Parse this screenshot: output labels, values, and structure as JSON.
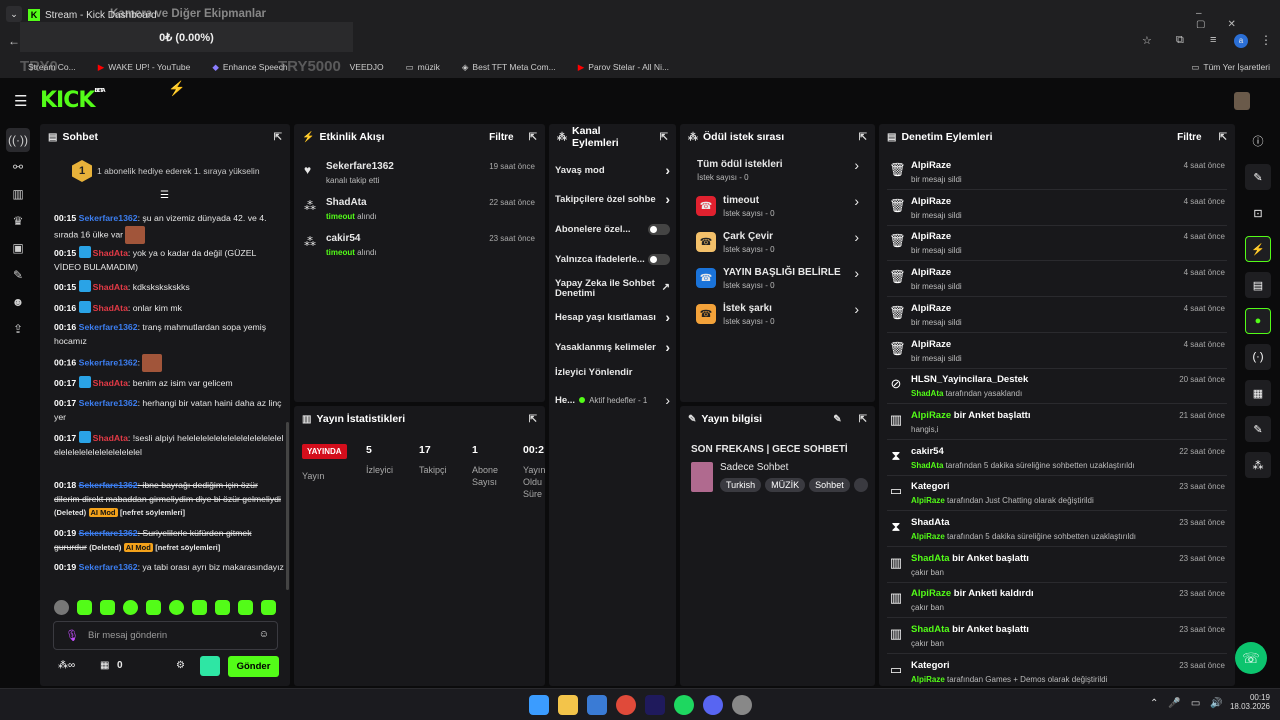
{
  "browser": {
    "tab_title": "Stream - Kick Dashboard",
    "overlay_title": "Kamera ve Diğer Ekipmanlar",
    "overlay_value": "0₺ (0.00%)",
    "watermark_left": "TRY0",
    "watermark_right": "TRY5000",
    "bookmarks": [
      "Stream Co...",
      "WAKE UP! - YouTube",
      "Enhance Speech",
      "VEEDJO",
      "müzik",
      "Best TFT Meta Com...",
      "Parov Stelar - All Ni..."
    ],
    "bookmarks_all": "Tüm Yer İşaretleri"
  },
  "kick": {
    "logo": "KICK",
    "beta": "BETA"
  },
  "chat": {
    "title": "Sohbet",
    "promo": "1 abonelik hediye ederek 1. sıraya yükselin",
    "promo_rank": "1",
    "messages": [
      {
        "time": "00:15",
        "user": "Sekerfare1362",
        "text": ": şu an vizemiz dünyada 42. ve 4. sırada 16 ülke var"
      },
      {
        "time": "00:15",
        "user": "ShadAta",
        "text": ": yok ya o kadar da değil (GÜZEL VİDEO BULAMADIM)"
      },
      {
        "time": "00:15",
        "user": "ShadAta",
        "text": ": kdkskskskskks"
      },
      {
        "time": "00:16",
        "user": "ShadAta",
        "text": ": onlar kim mk"
      },
      {
        "time": "00:16",
        "user": "Sekerfare1362",
        "text": ": tranş mahmutlardan sopa yemiş hocamız"
      },
      {
        "time": "00:16",
        "user": "Sekerfare1362",
        "text": ":"
      },
      {
        "time": "00:17",
        "user": "ShadAta",
        "text": ": benim az isim var gelicem"
      },
      {
        "time": "00:17",
        "user": "Sekerfare1362",
        "text": ": herhangi bir vatan haini daha az linç yer"
      },
      {
        "time": "00:17",
        "user": "ShadAta",
        "text": ": !sesli alpiyi helelelelelelelelelelelelelelelelelelelelelelelelelelelel"
      },
      {
        "time": "00:18",
        "user": "Sekerfare1362",
        "text": ": ibne bayrağı dediğim için özür dilerim direkt mabaddan girmeliydim diye bi özür gelmeliydi",
        "deleted": "(Deleted)",
        "mod": "AI Mod",
        "reason": "[nefret söylemleri]"
      },
      {
        "time": "00:19",
        "user": "Sekerfare1362",
        "text": ": Suriyelilerle küfürden gitmek gururdur",
        "deleted": "(Deleted)",
        "mod": "AI Mod",
        "reason": "[nefret söylemleri]"
      },
      {
        "time": "00:19",
        "user": "Sekerfare1362",
        "text": ": ya tabi orası ayrı biz makarasındayız"
      }
    ],
    "input_placeholder": "Bir mesaj gönderin",
    "points": "0",
    "send_label": "Gönder"
  },
  "activity": {
    "title": "Etkinlik Akışı",
    "filter": "Filtre",
    "items": [
      {
        "user": "Sekerfare1362",
        "sub": "kanalı takip etti",
        "time": "19 saat önce"
      },
      {
        "user": "ShadAta",
        "sub_hl": "timeout",
        "sub": " alındı",
        "time": "22 saat önce"
      },
      {
        "user": "cakir54",
        "sub_hl": "timeout",
        "sub": " alındı",
        "time": "23 saat önce"
      }
    ]
  },
  "channel": {
    "title": "Kanal Eylemleri",
    "items": [
      "Yavaş mod",
      "Takipçilere özel sohbe",
      "Abonelere özel...",
      "Yalnızca ifadelerle...",
      "Yapay Zeka ile Sohbet Denetimi",
      "Hesap yaşı kısıtlaması",
      "Yasaklanmış kelimeler",
      "İzleyici Yönlendir"
    ],
    "last_label": "He...",
    "last_sub": "Aktif hedefler - 1"
  },
  "rewards": {
    "title": "Ödül istek sırası",
    "all": "Tüm ödül istekleri",
    "all_sub": "İstek sayısı - 0",
    "items": [
      {
        "name": "timeout",
        "sub": "İstek sayısı - 0",
        "color": "#e0212f"
      },
      {
        "name": "Çark Çevir",
        "sub": "İstek sayısı - 0",
        "color": "#f3c06a"
      },
      {
        "name": "YAYIN BAŞLIĞI BELİRLE",
        "sub": "İstek sayısı - 0",
        "color": "#1a73d9"
      },
      {
        "name": "İstek şarkı",
        "sub": "İstek sayısı - 0",
        "color": "#f3a23a"
      }
    ]
  },
  "stats": {
    "title": "Yayın İstatistikleri",
    "live": "YAYINDA",
    "yayin": "Yayın",
    "values": [
      {
        "n": "5",
        "l": "İzleyici"
      },
      {
        "n": "17",
        "l": "Takipçi"
      },
      {
        "n": "1",
        "l": "Abone Sayısı"
      },
      {
        "n": "00:2:",
        "l": "Yayın Oldu Süre"
      }
    ]
  },
  "streaminfo": {
    "title": "Yayın bilgisi",
    "stream_title": "SON FREKANS | GECE SOHBETİ",
    "category": "Sadece Sohbet",
    "tags": [
      "Turkish",
      "MÜZİK",
      "Sohbet"
    ]
  },
  "moderation": {
    "title": "Denetim Eylemleri",
    "filter": "Filtre",
    "rows": [
      {
        "icon": "trash-icon",
        "glyph": "🗑",
        "title": "AlpiRaze",
        "sub": "bir mesajı sildi",
        "time": "4 saat önce"
      },
      {
        "icon": "trash-icon",
        "glyph": "🗑",
        "title": "AlpiRaze",
        "sub": "bir mesajı sildi",
        "time": "4 saat önce"
      },
      {
        "icon": "trash-icon",
        "glyph": "🗑",
        "title": "AlpiRaze",
        "sub": "bir mesajı sildi",
        "time": "4 saat önce"
      },
      {
        "icon": "trash-icon",
        "glyph": "🗑",
        "title": "AlpiRaze",
        "sub": "bir mesajı sildi",
        "time": "4 saat önce"
      },
      {
        "icon": "trash-icon",
        "glyph": "🗑",
        "title": "AlpiRaze",
        "sub": "bir mesajı sildi",
        "time": "4 saat önce"
      },
      {
        "icon": "trash-icon",
        "glyph": "🗑",
        "title": "AlpiRaze",
        "sub": "bir mesajı sildi",
        "time": "4 saat önce"
      },
      {
        "icon": "ban-icon",
        "glyph": "⊘",
        "title": "HLSN_Yayincilara_Destek",
        "sub_hl": "ShadAta",
        "sub": " tarafından yasaklandı",
        "time": "20 saat önce"
      },
      {
        "icon": "poll-icon",
        "glyph": "▥",
        "title_hl": "AlpiRaze",
        "title": " bir Anket başlattı",
        "sub": "hangis,i",
        "time": "21 saat önce"
      },
      {
        "icon": "hourglass-icon",
        "glyph": "⧗",
        "title": "cakir54",
        "sub_hl": "ShadAta",
        "sub": " tarafından 5 dakika süreliğine sohbetten uzaklaştırıldı",
        "time": "22 saat önce"
      },
      {
        "icon": "category-icon",
        "glyph": "▭",
        "title": "Kategori",
        "sub_hl": "AlpiRaze",
        "sub": " tarafından Just Chatting olarak değiştirildi",
        "time": "23 saat önce"
      },
      {
        "icon": "hourglass-icon",
        "glyph": "⧗",
        "title": "ShadAta",
        "sub_hl": "AlpiRaze",
        "sub": " tarafından 5 dakika süreliğine sohbetten uzaklaştırıldı",
        "time": "23 saat önce"
      },
      {
        "icon": "poll-icon",
        "glyph": "▥",
        "title_hl": "ShadAta",
        "title": " bir Anket başlattı",
        "sub": "çakır ban",
        "time": "23 saat önce"
      },
      {
        "icon": "poll-icon",
        "glyph": "▥",
        "title_hl": "AlpiRaze",
        "title": " bir Anketi kaldırdı",
        "sub": "çakır ban",
        "time": "23 saat önce"
      },
      {
        "icon": "poll-icon",
        "glyph": "▥",
        "title_hl": "ShadAta",
        "title": " bir Anket başlattı",
        "sub": "çakır ban",
        "time": "23 saat önce"
      },
      {
        "icon": "category-icon",
        "glyph": "▭",
        "title": "Kategori",
        "sub_hl": "AlpiRaze",
        "sub": " tarafından Games + Demos olarak değiştirildi",
        "time": "23 saat önce"
      }
    ]
  },
  "taskbar": {
    "time": "00:19",
    "date": "18.03.2026"
  },
  "colors": {
    "accent": "#53fc18",
    "panel": "#18181b",
    "bg": "#0b0b0c"
  }
}
